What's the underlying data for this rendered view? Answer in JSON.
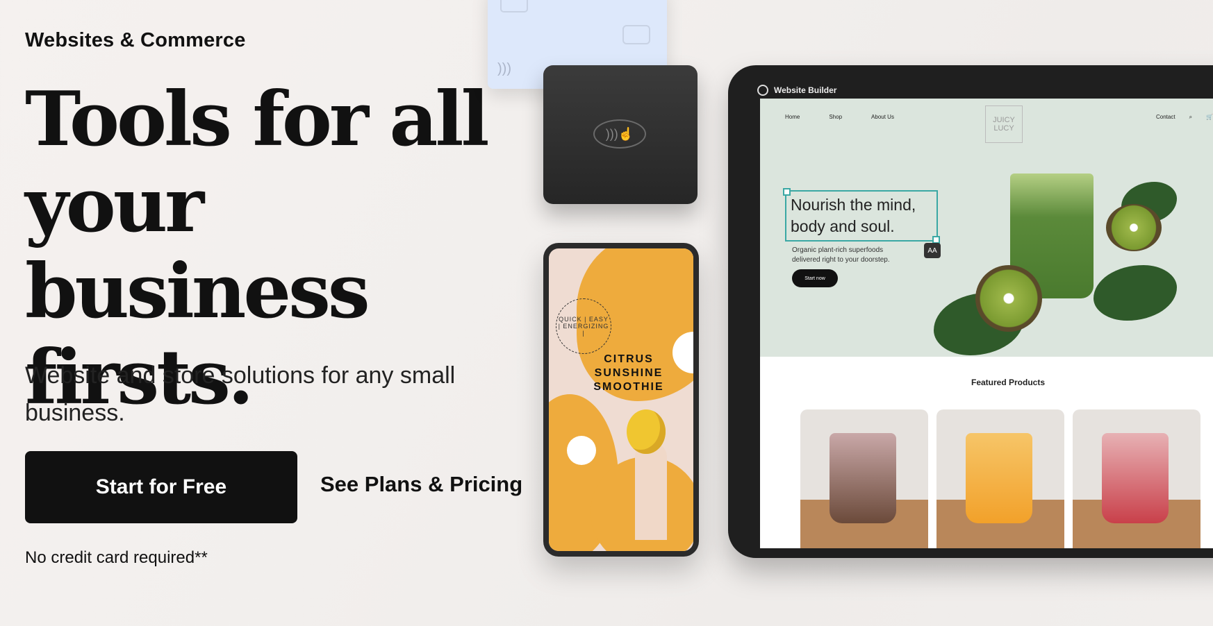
{
  "hero": {
    "eyebrow": "Websites & Commerce",
    "headline": "Tools for all your business firsts.",
    "subhead": "Website and store solutions for any small business.",
    "primary_cta": "Start for Free",
    "secondary_cta": "See Plans & Pricing",
    "disclaimer": "No credit card required**"
  },
  "phone": {
    "badge": "QUICK | EASY | ENERGIZING |",
    "title": "CITRUS SUNSHINE SMOOTHIE"
  },
  "tablet": {
    "app_name": "Website Builder",
    "nav": [
      "Home",
      "Shop",
      "About Us"
    ],
    "nav_right": [
      "Contact"
    ],
    "brand": "JUICY LUCY",
    "hero_heading": "Nourish the mind, body and soul.",
    "hero_sub": "Organic plant-rich superfoods delivered right to your doorstep.",
    "hero_button": "Start now",
    "aa_chip": "AA",
    "featured": "Featured Products"
  },
  "colors": {
    "background": "#f2efed",
    "primary_button": "#111111",
    "card_blue": "#dde8fb",
    "phone_orange": "#eeab3d",
    "selection_teal": "#3aa8a4",
    "site_hero_bg": "#dbe5dd"
  }
}
